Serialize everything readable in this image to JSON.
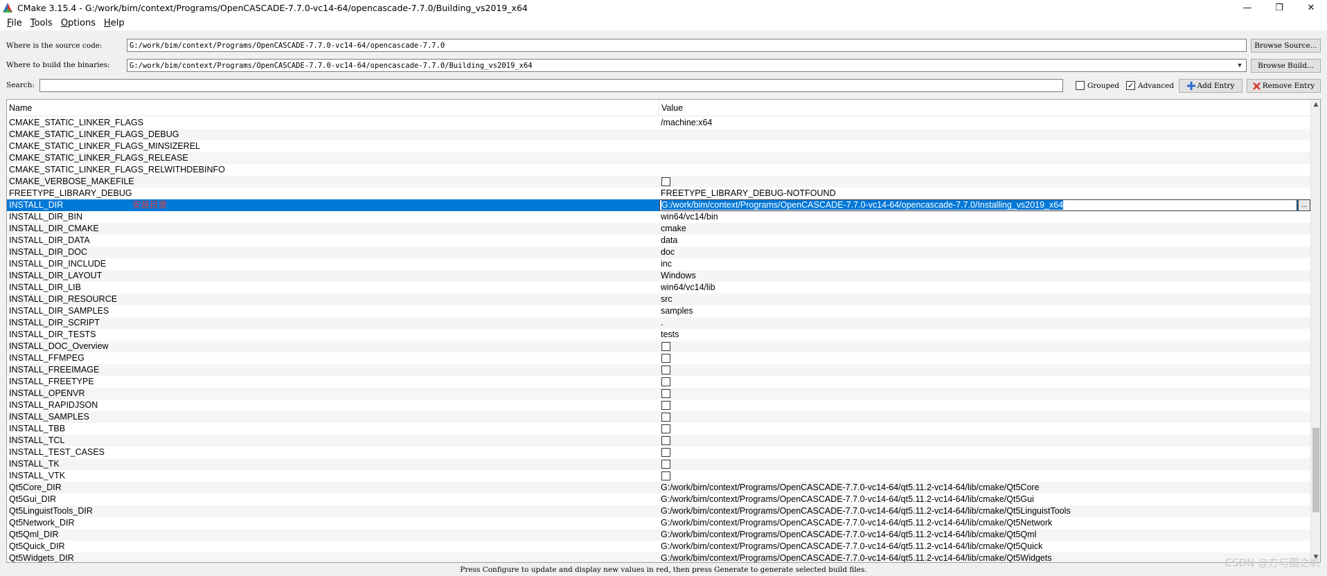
{
  "window": {
    "title": "CMake 3.15.4 - G:/work/bim/context/Programs/OpenCASCADE-7.7.0-vc14-64/opencascade-7.7.0/Building_vs2019_x64",
    "minimize": "—",
    "restore": "❐",
    "close": "✕"
  },
  "menu": [
    {
      "ul": "F",
      "rest": "ile"
    },
    {
      "ul": "T",
      "rest": "ools"
    },
    {
      "ul": "O",
      "rest": "ptions"
    },
    {
      "ul": "H",
      "rest": "elp"
    }
  ],
  "source": {
    "label": "Where is the source code:",
    "value": "G:/work/bim/context/Programs/OpenCASCADE-7.7.0-vc14-64/opencascade-7.7.0",
    "button": "Browse Source..."
  },
  "build": {
    "label": "Where to build the binaries:",
    "value": "G:/work/bim/context/Programs/OpenCASCADE-7.7.0-vc14-64/opencascade-7.7.0/Building_vs2019_x64",
    "button": "Browse Build..."
  },
  "search": {
    "label": "Search:",
    "value": ""
  },
  "options": {
    "grouped": {
      "label": "Grouped",
      "checked": false
    },
    "advanced": {
      "label": "Advanced",
      "checked": true
    },
    "add_entry": "Add Entry",
    "remove_entry": "Remove Entry"
  },
  "table": {
    "headers": {
      "name": "Name",
      "value": "Value"
    },
    "selected_annotation": "安装目录",
    "edit_button": "...",
    "rows": [
      {
        "name": "CMAKE_STATIC_LINKER_FLAGS",
        "value": "/machine:x64",
        "type": "text"
      },
      {
        "name": "CMAKE_STATIC_LINKER_FLAGS_DEBUG",
        "value": "",
        "type": "text"
      },
      {
        "name": "CMAKE_STATIC_LINKER_FLAGS_MINSIZEREL",
        "value": "",
        "type": "text"
      },
      {
        "name": "CMAKE_STATIC_LINKER_FLAGS_RELEASE",
        "value": "",
        "type": "text"
      },
      {
        "name": "CMAKE_STATIC_LINKER_FLAGS_RELWITHDEBINFO",
        "value": "",
        "type": "text"
      },
      {
        "name": "CMAKE_VERBOSE_MAKEFILE",
        "value": "",
        "type": "bool"
      },
      {
        "name": "FREETYPE_LIBRARY_DEBUG",
        "value": "FREETYPE_LIBRARY_DEBUG-NOTFOUND",
        "type": "text"
      },
      {
        "name": "INSTALL_DIR",
        "value": "G:/work/bim/context/Programs/OpenCASCADE-7.7.0-vc14-64/opencascade-7.7.0/Installing_vs2019_x64",
        "type": "edit",
        "selected": true
      },
      {
        "name": "INSTALL_DIR_BIN",
        "value": "win64/vc14/bin",
        "type": "text"
      },
      {
        "name": "INSTALL_DIR_CMAKE",
        "value": "cmake",
        "type": "text"
      },
      {
        "name": "INSTALL_DIR_DATA",
        "value": "data",
        "type": "text"
      },
      {
        "name": "INSTALL_DIR_DOC",
        "value": "doc",
        "type": "text"
      },
      {
        "name": "INSTALL_DIR_INCLUDE",
        "value": "inc",
        "type": "text"
      },
      {
        "name": "INSTALL_DIR_LAYOUT",
        "value": "Windows",
        "type": "text"
      },
      {
        "name": "INSTALL_DIR_LIB",
        "value": "win64/vc14/lib",
        "type": "text"
      },
      {
        "name": "INSTALL_DIR_RESOURCE",
        "value": "src",
        "type": "text"
      },
      {
        "name": "INSTALL_DIR_SAMPLES",
        "value": "samples",
        "type": "text"
      },
      {
        "name": "INSTALL_DIR_SCRIPT",
        "value": ".",
        "type": "text"
      },
      {
        "name": "INSTALL_DIR_TESTS",
        "value": "tests",
        "type": "text"
      },
      {
        "name": "INSTALL_DOC_Overview",
        "value": "",
        "type": "bool"
      },
      {
        "name": "INSTALL_FFMPEG",
        "value": "",
        "type": "bool"
      },
      {
        "name": "INSTALL_FREEIMAGE",
        "value": "",
        "type": "bool"
      },
      {
        "name": "INSTALL_FREETYPE",
        "value": "",
        "type": "bool"
      },
      {
        "name": "INSTALL_OPENVR",
        "value": "",
        "type": "bool"
      },
      {
        "name": "INSTALL_RAPIDJSON",
        "value": "",
        "type": "bool"
      },
      {
        "name": "INSTALL_SAMPLES",
        "value": "",
        "type": "bool"
      },
      {
        "name": "INSTALL_TBB",
        "value": "",
        "type": "bool"
      },
      {
        "name": "INSTALL_TCL",
        "value": "",
        "type": "bool"
      },
      {
        "name": "INSTALL_TEST_CASES",
        "value": "",
        "type": "bool"
      },
      {
        "name": "INSTALL_TK",
        "value": "",
        "type": "bool"
      },
      {
        "name": "INSTALL_VTK",
        "value": "",
        "type": "bool"
      },
      {
        "name": "Qt5Core_DIR",
        "value": "G:/work/bim/context/Programs/OpenCASCADE-7.7.0-vc14-64/qt5.11.2-vc14-64/lib/cmake/Qt5Core",
        "type": "text"
      },
      {
        "name": "Qt5Gui_DIR",
        "value": "G:/work/bim/context/Programs/OpenCASCADE-7.7.0-vc14-64/qt5.11.2-vc14-64/lib/cmake/Qt5Gui",
        "type": "text"
      },
      {
        "name": "Qt5LinguistTools_DIR",
        "value": "G:/work/bim/context/Programs/OpenCASCADE-7.7.0-vc14-64/qt5.11.2-vc14-64/lib/cmake/Qt5LinguistTools",
        "type": "text"
      },
      {
        "name": "Qt5Network_DIR",
        "value": "G:/work/bim/context/Programs/OpenCASCADE-7.7.0-vc14-64/qt5.11.2-vc14-64/lib/cmake/Qt5Network",
        "type": "text"
      },
      {
        "name": "Qt5Qml_DIR",
        "value": "G:/work/bim/context/Programs/OpenCASCADE-7.7.0-vc14-64/qt5.11.2-vc14-64/lib/cmake/Qt5Qml",
        "type": "text"
      },
      {
        "name": "Qt5Quick_DIR",
        "value": "G:/work/bim/context/Programs/OpenCASCADE-7.7.0-vc14-64/qt5.11.2-vc14-64/lib/cmake/Qt5Quick",
        "type": "text"
      },
      {
        "name": "Qt5Widgets_DIR",
        "value": "G:/work/bim/context/Programs/OpenCASCADE-7.7.0-vc14-64/qt5.11.2-vc14-64/lib/cmake/Qt5Widgets",
        "type": "text"
      }
    ]
  },
  "status_text": "Press Configure to update and display new values in red, then press Generate to generate selected build files.",
  "watermark": "CSDN @方与圆之帆",
  "colors": {
    "selection": "#0078d7",
    "annotation": "#e23b3b",
    "remove_icon": "#d9342b",
    "add_icon": "#2a6bd6"
  }
}
